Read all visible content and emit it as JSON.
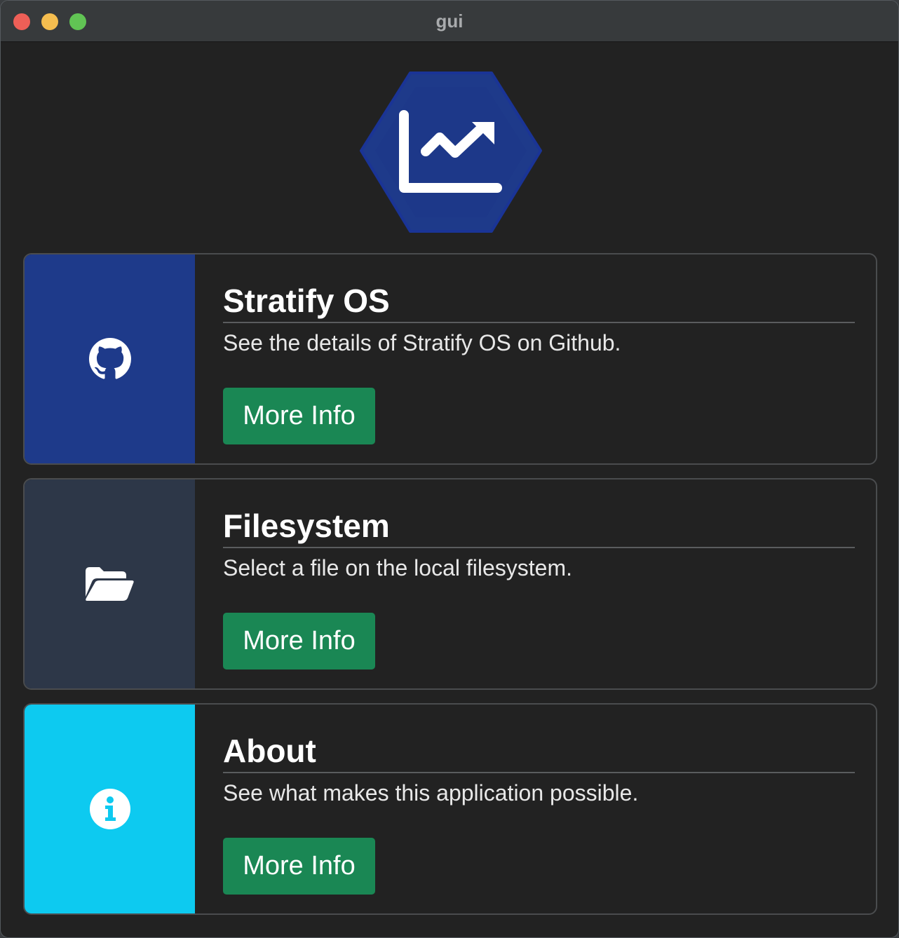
{
  "window": {
    "title": "gui"
  },
  "logo": {
    "icon": "chart-line-icon",
    "color": "#1e3a8a"
  },
  "cards": [
    {
      "title": "Stratify OS",
      "description": "See the details of Stratify OS on Github.",
      "button": "More Info",
      "icon": "github-icon",
      "color": "#1e3a8a"
    },
    {
      "title": "Filesystem",
      "description": "Select a file on the local filesystem.",
      "button": "More Info",
      "icon": "folder-open-icon",
      "color": "#2d3748"
    },
    {
      "title": "About",
      "description": "See what makes this application possible.",
      "button": "More Info",
      "icon": "info-circle-icon",
      "color": "#0dcaf0"
    }
  ]
}
